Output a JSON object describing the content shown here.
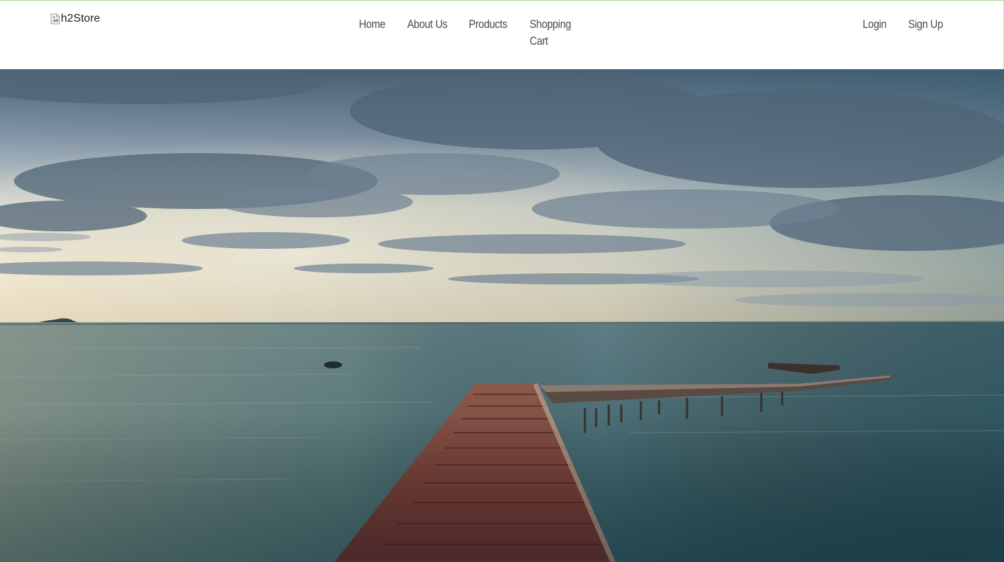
{
  "brand": {
    "logo_alt": "h2Store"
  },
  "nav": {
    "main": [
      {
        "label": "Home"
      },
      {
        "label": "About Us"
      },
      {
        "label": "Products"
      },
      {
        "label": "Shopping Cart"
      }
    ],
    "account": [
      {
        "label": "Login"
      },
      {
        "label": "Sign Up"
      }
    ]
  },
  "hero": {
    "image_subject": "seascape-pier-photo"
  },
  "colors": {
    "nav_text": "#4a4a4a",
    "top_accent_border": "#a9d49a",
    "sea": "#3e6f78",
    "pier": "#7a3b34"
  }
}
